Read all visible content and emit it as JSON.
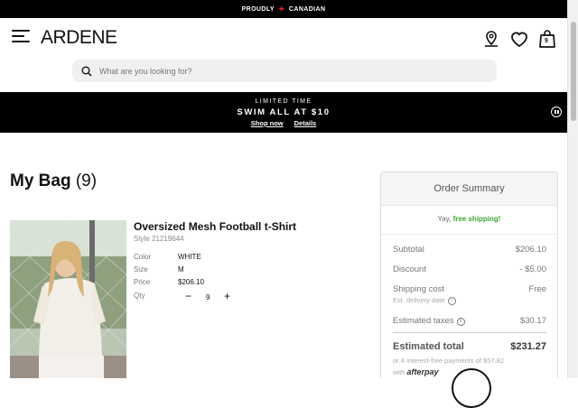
{
  "announcement": {
    "left": "PROUDLY",
    "right": "CANADIAN"
  },
  "header": {
    "logo": "ARDENE",
    "cart_count": "9"
  },
  "search": {
    "placeholder": "What are you looking for?"
  },
  "promo": {
    "line1": "LIMITED TIME",
    "line2": "SWIM ALL AT $10",
    "shop_now": "Shop now",
    "details": "Details"
  },
  "bag": {
    "title": "My Bag",
    "count": "(9)"
  },
  "item": {
    "name": "Oversized Mesh Football t-Shirt",
    "style": "Style 21219644",
    "color_label": "Color",
    "color_value": "WHITE",
    "size_label": "Size",
    "size_value": "M",
    "price_label": "Price",
    "price_value": "$206.10",
    "qty_label": "Qty",
    "qty_value": "9",
    "minus": "−",
    "plus": "+"
  },
  "summary": {
    "title": "Order Summary",
    "ship_prefix": "Yay,",
    "ship_free": "free shipping!",
    "subtotal_label": "Subtotal",
    "subtotal_value": "$206.10",
    "discount_label": "Discount",
    "discount_value": "- $5.00",
    "shipping_label": "Shipping cost",
    "shipping_value": "Free",
    "delivery_note": "Est. delivery date",
    "taxes_label": "Estimated taxes",
    "taxes_value": "$30.17",
    "total_label": "Estimated total",
    "total_value": "$231.27",
    "afterpay_line1": "or 4 interest-free payments of $57.82",
    "afterpay_with": "with",
    "afterpay_brand": "afterpay"
  },
  "colors": {
    "accent_green": "#3aaa35",
    "flag_red": "#e01b22",
    "bar_black": "#000000"
  }
}
